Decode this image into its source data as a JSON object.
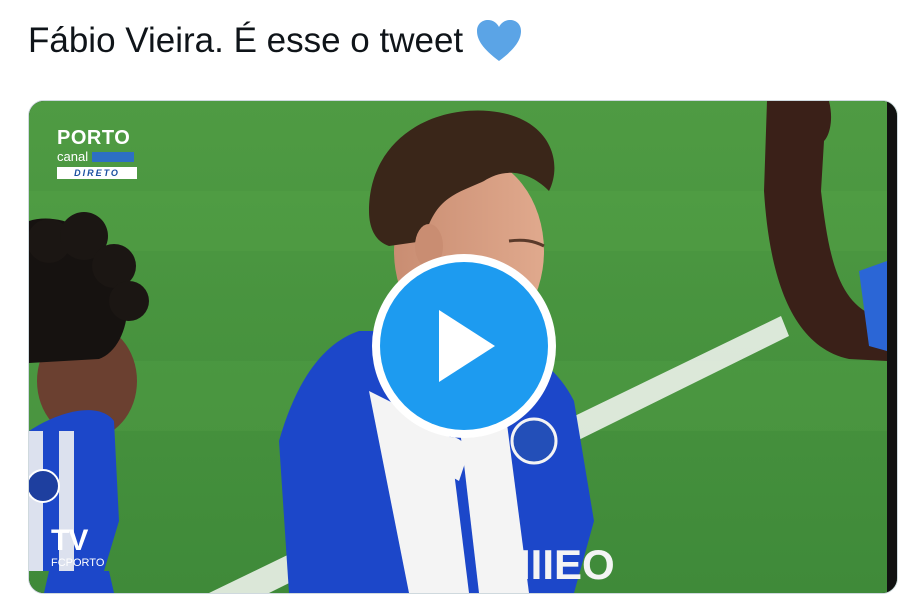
{
  "tweet": {
    "text": "Fábio Vieira. É esse o tweet",
    "emoji": "blue-heart"
  },
  "video": {
    "channel_logo": {
      "line1": "PORTO",
      "line2": "canal",
      "badge": "DIRETO"
    },
    "corner_logo": {
      "mark": "TV",
      "caption": "FCPORTO"
    },
    "play_button": "play"
  },
  "colors": {
    "accent": "#1d9bf0",
    "heart": "#5ba4e6",
    "pitch": "#4a9a3f",
    "kit_blue": "#1c47c9"
  }
}
